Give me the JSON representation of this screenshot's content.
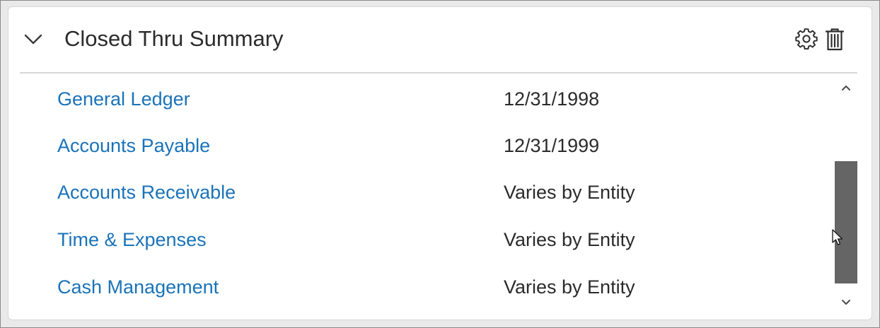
{
  "widget": {
    "title": "Closed Thru Summary",
    "icons": {
      "collapse": "chevron-down-icon",
      "settings": "gear-icon",
      "delete": "trash-icon"
    }
  },
  "rows": [
    {
      "module": "General Ledger",
      "closed_thru": "12/31/1998"
    },
    {
      "module": "Accounts Payable",
      "closed_thru": "12/31/1999"
    },
    {
      "module": "Accounts Receivable",
      "closed_thru": "Varies by Entity"
    },
    {
      "module": "Time & Expenses",
      "closed_thru": "Varies by Entity"
    },
    {
      "module": "Cash Management",
      "closed_thru": "Varies by Entity"
    }
  ],
  "colors": {
    "link": "#1a73b9",
    "text": "#2b2b2b",
    "scroll_thumb": "#656565",
    "divider": "#d8d8d8"
  },
  "scrollbar": {
    "up_icon": "chevron-up-icon",
    "down_icon": "chevron-down-icon"
  }
}
